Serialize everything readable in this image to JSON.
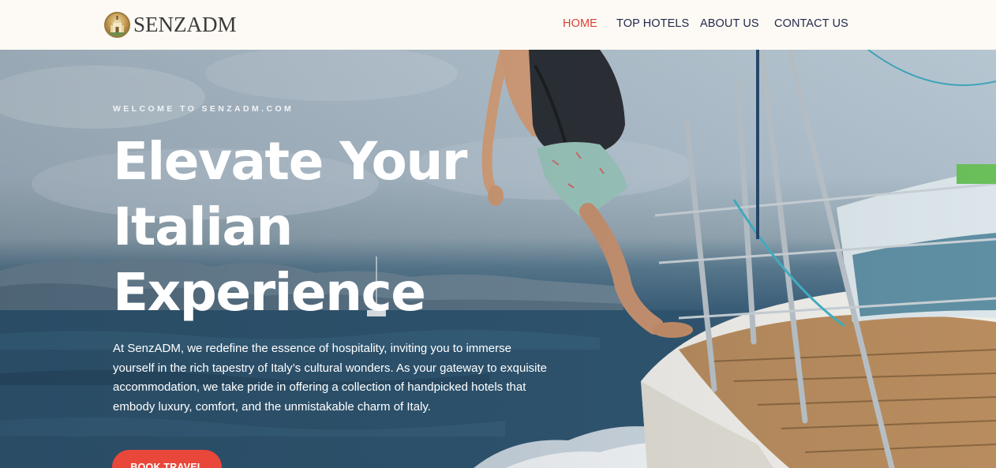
{
  "brand": {
    "name": "SENZADM",
    "emblem_icon": "cathedral-emblem-icon"
  },
  "nav": {
    "items": [
      {
        "label": "HOME",
        "active": true
      },
      {
        "label": "TOP HOTELS",
        "active": false
      },
      {
        "label": "ABOUT US",
        "active": false
      },
      {
        "label": "CONTACT US",
        "active": false
      }
    ]
  },
  "hero": {
    "eyebrow": "WELCOME TO SENZADM.COM",
    "headline": "Elevate Your Italian Experience",
    "intro": "At SenzADM, we redefine the essence of hospitality, inviting you to immerse yourself in the rich tapestry of Italy’s cultural wonders. As your gateway to exquisite accommodation, we take pride in offering a collection of handpicked hotels that embody luxury, comfort, and the unmistakable charm of Italy.",
    "cta_label": "BOOK TRAVEL",
    "background_image": "man-jumping-off-sailboat-photo"
  },
  "colors": {
    "accent": "#e9473a",
    "nav_active": "#d84236",
    "nav_text": "#222a4a",
    "header_bg": "#fdfaf5"
  }
}
